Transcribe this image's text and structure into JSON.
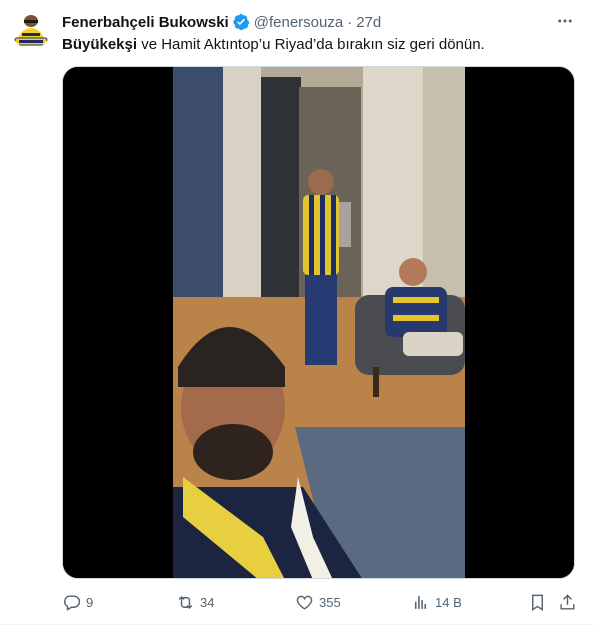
{
  "author": {
    "display_name": "Fenerbahçeli Bukowski",
    "handle": "@fenersouza",
    "separator": "·",
    "time": "27d",
    "verified_icon": "verified-badge-icon"
  },
  "tweet": {
    "text_bold": "Büyükekşi",
    "text_rest": " ve Hamit Aktıntop’u Riyad’da bırakın siz geri dönün."
  },
  "actions": {
    "replies": "9",
    "retweets": "34",
    "likes": "355",
    "views": "14 B"
  },
  "colors": {
    "accent": "#1d9bf0",
    "muted": "#536471",
    "text": "#0f1419"
  }
}
